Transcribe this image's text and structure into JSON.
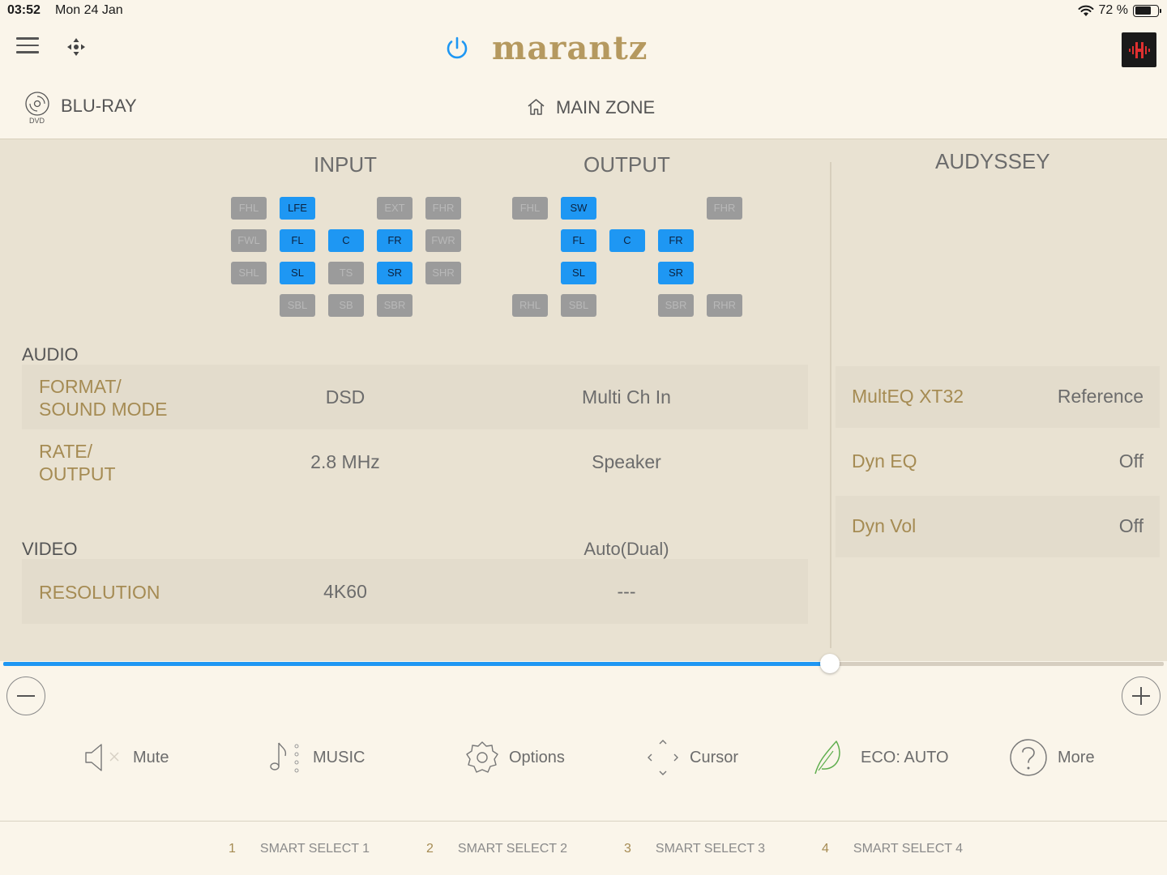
{
  "status": {
    "time": "03:52",
    "date": "Mon 24 Jan",
    "battery": "72 %",
    "battery_level": 0.72
  },
  "header": {
    "brand": "marantz"
  },
  "source": {
    "label": "BLU-RAY",
    "icon_caption": "DVD"
  },
  "zone": {
    "label": "MAIN ZONE"
  },
  "columns": {
    "input": "INPUT",
    "output": "OUTPUT",
    "audyssey": "AUDYSSEY"
  },
  "input_channels": [
    {
      "label": "FHL",
      "active": false
    },
    {
      "label": "LFE",
      "active": true
    },
    {
      "label": "EXT",
      "active": false
    },
    {
      "label": "FHR",
      "active": false
    },
    {
      "label": "FWL",
      "active": false
    },
    {
      "label": "FL",
      "active": true
    },
    {
      "label": "C",
      "active": true
    },
    {
      "label": "FR",
      "active": true
    },
    {
      "label": "FWR",
      "active": false
    },
    {
      "label": "SHL",
      "active": false
    },
    {
      "label": "SL",
      "active": true
    },
    {
      "label": "TS",
      "active": false
    },
    {
      "label": "SR",
      "active": true
    },
    {
      "label": "SHR",
      "active": false
    },
    {
      "label": "SBL",
      "active": false
    },
    {
      "label": "SB",
      "active": false
    },
    {
      "label": "SBR",
      "active": false
    }
  ],
  "output_channels": [
    {
      "label": "FHL",
      "active": false
    },
    {
      "label": "SW",
      "active": true
    },
    {
      "label": "FHR",
      "active": false
    },
    {
      "label": "FL",
      "active": true
    },
    {
      "label": "C",
      "active": true
    },
    {
      "label": "FR",
      "active": true
    },
    {
      "label": "SL",
      "active": true
    },
    {
      "label": "SR",
      "active": true
    },
    {
      "label": "RHL",
      "active": false
    },
    {
      "label": "SBL",
      "active": false
    },
    {
      "label": "SBR",
      "active": false
    },
    {
      "label": "RHR",
      "active": false
    }
  ],
  "audio": {
    "section": "AUDIO",
    "format_label_1": "FORMAT/",
    "format_label_2": "SOUND MODE",
    "format_input": "DSD",
    "format_output": "Multi Ch In",
    "rate_label_1": "RATE/",
    "rate_label_2": "OUTPUT",
    "rate_input": "2.8 MHz",
    "rate_output": "Speaker"
  },
  "video": {
    "section": "VIDEO",
    "output_mode": "Auto(Dual)",
    "resolution_label": "RESOLUTION",
    "resolution_input": "4K60",
    "resolution_output": "---"
  },
  "audyssey": [
    {
      "label": "MultEQ XT32",
      "value": "Reference"
    },
    {
      "label": "Dyn EQ",
      "value": "Off"
    },
    {
      "label": "Dyn Vol",
      "value": "Off"
    }
  ],
  "volume": {
    "level": 0.712
  },
  "actions": {
    "mute": "Mute",
    "music": "MUSIC",
    "options": "Options",
    "cursor": "Cursor",
    "eco": "ECO: AUTO",
    "more": "More"
  },
  "smart_select": [
    {
      "num": "1",
      "label": "SMART SELECT 1"
    },
    {
      "num": "2",
      "label": "SMART SELECT 2"
    },
    {
      "num": "3",
      "label": "SMART SELECT 3"
    },
    {
      "num": "4",
      "label": "SMART SELECT 4"
    }
  ],
  "colors": {
    "accent": "#1e97f3",
    "gold": "#a58b53",
    "eco": "#5fae4e"
  }
}
